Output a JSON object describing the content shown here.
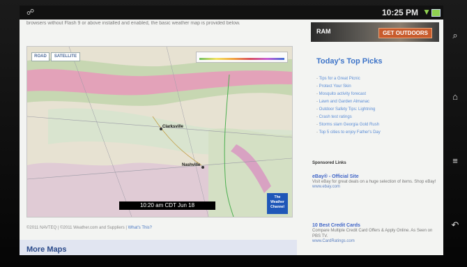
{
  "statusbar": {
    "time": "10:25 PM",
    "left_icon": "usb-icon",
    "wifi_icon": "wifi-icon",
    "battery_icon": "battery-icon"
  },
  "page": {
    "top_text": "browsers without Flash 9 or above installed and enabled, the basic weather map is provided below."
  },
  "map": {
    "tabs": [
      "ROAD",
      "SATELLITE"
    ],
    "timestamp": "10:20 am CDT Jun 18",
    "logo_line1": "The",
    "logo_line2": "Weather",
    "logo_line3": "Channel",
    "cities": [
      "Clarksville",
      "Nashville"
    ],
    "copyright_1": "©2011 NAVTEQ",
    "copyright_2": "©2011 Weather.com and Suppliers",
    "whats_this": "What's This?"
  },
  "more_maps": "More Maps",
  "ad": {
    "logo": "RAM",
    "cta": "GET OUTDOORS"
  },
  "picks": {
    "title": "Today's Top Picks",
    "items": [
      "Tips for a Great Picnic",
      "Protect Your Skin",
      "Mosquito activity forecast",
      "Lawn and Garden Almanac",
      "Outdoor Safety Tips: Lightning",
      "Crash test ratings",
      "Storms slam Georgia Gold Rush",
      "Top 5 cities to enjoy Father's Day"
    ]
  },
  "sponsored": {
    "header": "Sponsored Links",
    "ads": [
      {
        "title": "eBay® - Official Site",
        "desc": "Visit eBay for great deals on a huge selection of items. Shop eBay!",
        "url": "www.ebay.com"
      },
      {
        "title": "10 Best Credit Cards",
        "desc": "Compare Multiple Credit Card Offers & Apply Online. As Seen on PBS TV.",
        "url": "www.CardRatings.com"
      }
    ]
  },
  "nav": {
    "search_icon": "search-icon",
    "home_icon": "home-icon",
    "menu_icon": "menu-icon",
    "back_icon": "back-icon"
  },
  "colors": {
    "link": "#3c73c8",
    "ad_cta": "#c85b2c"
  }
}
